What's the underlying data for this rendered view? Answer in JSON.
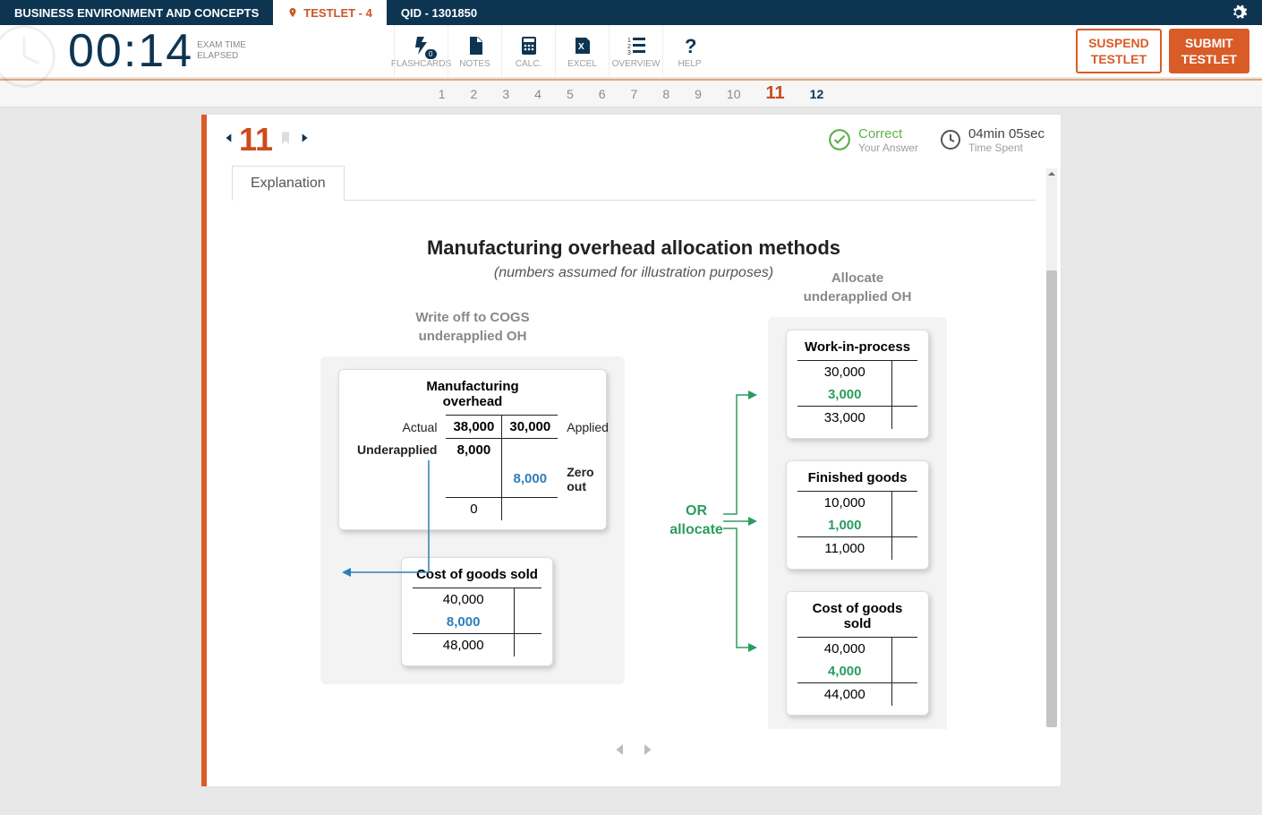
{
  "topbar": {
    "section_title": "BUSINESS ENVIRONMENT AND CONCEPTS",
    "testlet_label": "TESTLET - 4",
    "qid_label": "QID - 1301850"
  },
  "timer": {
    "value": "00:14",
    "label1": "EXAM TIME",
    "label2": "ELAPSED"
  },
  "tools": {
    "flashcards": "FLASHCARDS",
    "flashcards_badge": "0",
    "notes": "NOTES",
    "calc": "CALC.",
    "excel": "EXCEL",
    "overview": "OVERVIEW",
    "help": "HELP"
  },
  "actions": {
    "suspend": "SUSPEND\nTESTLET",
    "submit": "SUBMIT\nTESTLET"
  },
  "qnav": [
    "1",
    "2",
    "3",
    "4",
    "5",
    "6",
    "7",
    "8",
    "9",
    "10",
    "11",
    "12"
  ],
  "qnav_current": "11",
  "qnav_done": "12",
  "panel": {
    "question_number": "11",
    "correct_title": "Correct",
    "correct_sub": "Your Answer",
    "time_title": "04min 05sec",
    "time_sub": "Time Spent",
    "tab_label": "Explanation"
  },
  "content": {
    "title": "Manufacturing overhead allocation methods",
    "subtitle": "(numbers assumed for illustration purposes)",
    "left_label_1": "Write off to COGS",
    "left_label_2": "underapplied OH",
    "right_label_1": "Allocate",
    "right_label_2": "underapplied OH",
    "mid_label_1": "OR",
    "mid_label_2": "allocate",
    "moh": {
      "caption_1": "Manufacturing",
      "caption_2": "overhead",
      "actual_label": "Actual",
      "actual_val": "38,000",
      "applied_val": "30,000",
      "applied_label": "Applied",
      "under_label": "Underapplied",
      "under_val": "8,000",
      "zero_val": "8,000",
      "zero_label": "Zero out",
      "final": "0"
    },
    "cogs_left": {
      "caption": "Cost of goods sold",
      "r1": "40,000",
      "r2": "8,000",
      "r3": "48,000"
    },
    "wip": {
      "caption": "Work-in-process",
      "r1": "30,000",
      "r2": "3,000",
      "r3": "33,000"
    },
    "fg": {
      "caption": "Finished goods",
      "r1": "10,000",
      "r2": "1,000",
      "r3": "11,000"
    },
    "cogs_r": {
      "caption": "Cost of goods sold",
      "r1": "40,000",
      "r2": "4,000",
      "r3": "44,000"
    }
  }
}
